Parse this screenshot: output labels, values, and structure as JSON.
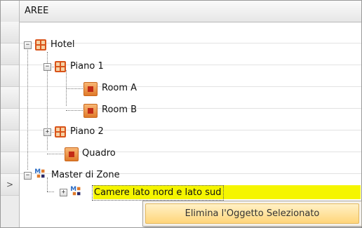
{
  "header": {
    "title": "AREE"
  },
  "tree": {
    "hotel": "Hotel",
    "piano1": "Piano 1",
    "roomA": "Room A",
    "roomB": "Room B",
    "piano2": "Piano 2",
    "quadro": "Quadro",
    "master": "Master di Zone",
    "camere": "Camere lato nord e lato sud"
  },
  "row_header": {
    "current_marker": ">"
  },
  "context_menu": {
    "delete_label": "Elimina l'Oggetto Selezionato"
  },
  "colors": {
    "selection": "#f5f500",
    "icon_orange": "#d9541a",
    "menu_highlight": "#ffd57a"
  },
  "icons": [
    "grid-area-icon",
    "room-icon",
    "zone-master-icon"
  ]
}
